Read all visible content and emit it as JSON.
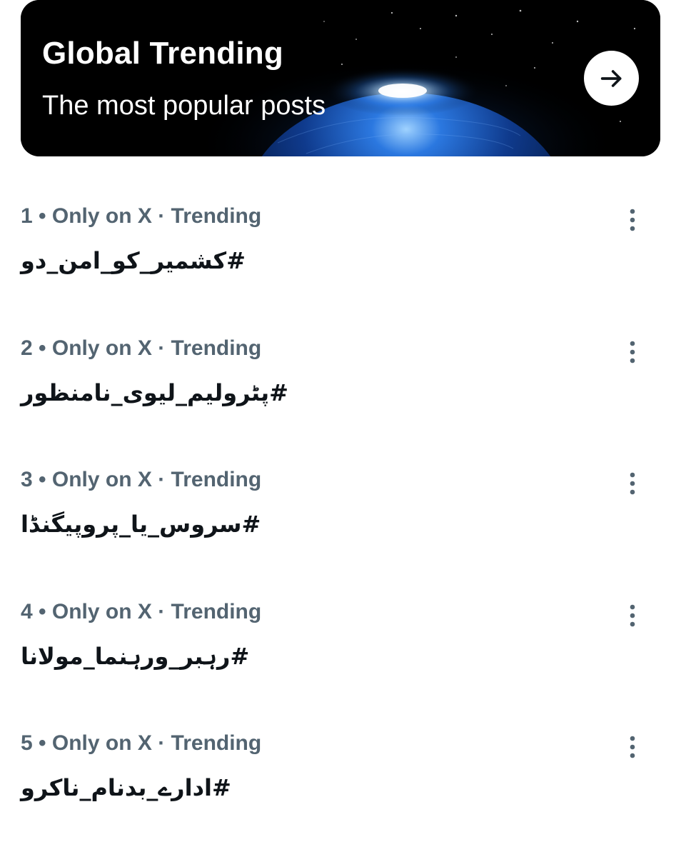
{
  "banner": {
    "title": "Global Trending",
    "subtitle": "The most popular posts",
    "arrow_icon": "arrow-right-icon"
  },
  "trends": [
    {
      "rank": "1",
      "context": "Only on X · Trending",
      "name": "#کشمیر_کو_امن_دو"
    },
    {
      "rank": "2",
      "context": "Only on X · Trending",
      "name": "#پٹرولیم_لیوی_نامنظور"
    },
    {
      "rank": "3",
      "context": "Only on X · Trending",
      "name": "#سروس_یا_پروپیگنڈا"
    },
    {
      "rank": "4",
      "context": "Only on X · Trending",
      "name": "#رہبر_ورہنما_مولانا"
    },
    {
      "rank": "5",
      "context": "Only on X · Trending",
      "name": "#ادارے_بدنام_ناکرو"
    }
  ],
  "more_icon": "more-vertical-icon",
  "colors": {
    "meta_text": "#536471",
    "trend_text": "#0f1419",
    "banner_bg": "#000000",
    "earth_blue": "#1e63c8"
  }
}
